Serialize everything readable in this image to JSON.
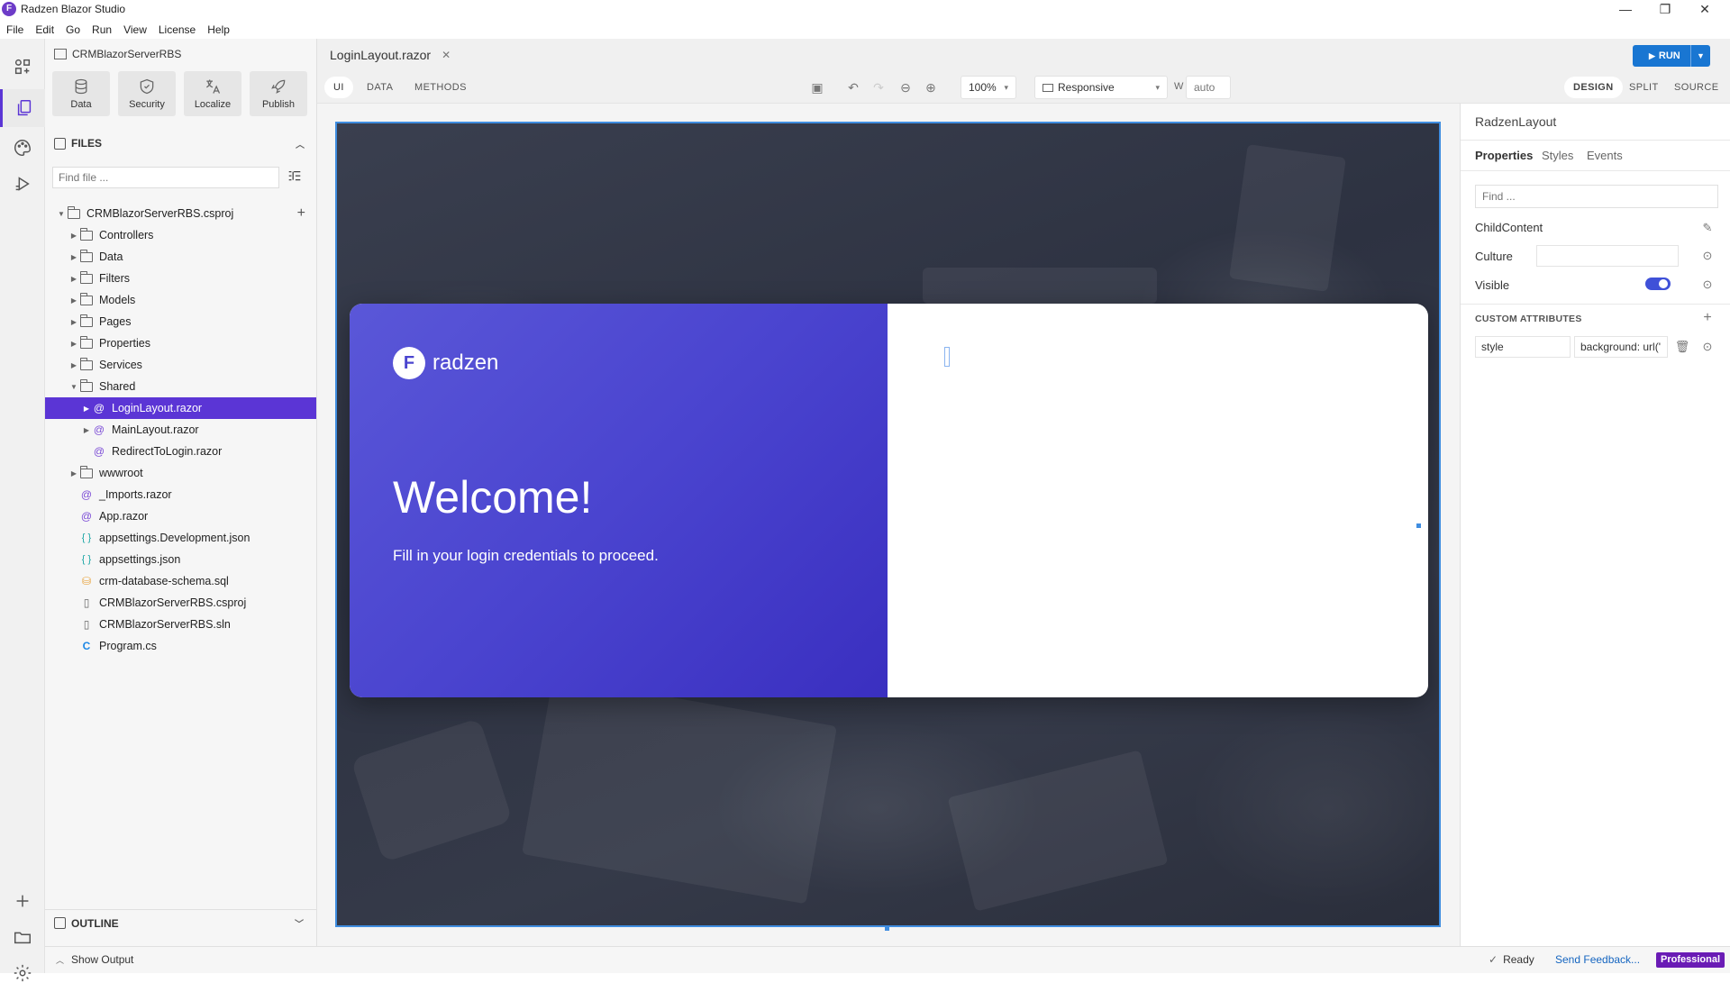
{
  "app": {
    "title": "Radzen Blazor Studio",
    "logo_letter": "F"
  },
  "window": {
    "minimize": "—",
    "maximize": "❐",
    "close": "✕"
  },
  "menu": [
    "File",
    "Edit",
    "Go",
    "Run",
    "View",
    "License",
    "Help"
  ],
  "sidebar": {
    "project": "CRMBlazorServerRBS",
    "tools": [
      {
        "label": "Data",
        "icon": "database-icon"
      },
      {
        "label": "Security",
        "icon": "shield-icon"
      },
      {
        "label": "Localize",
        "icon": "translate-icon"
      },
      {
        "label": "Publish",
        "icon": "rocket-icon"
      }
    ],
    "files_title": "FILES",
    "find_placeholder": "Find file ...",
    "tree": [
      {
        "label": "CRMBlazorServerRBS.csproj",
        "type": "folder",
        "level": 0,
        "expanded": true
      },
      {
        "label": "Controllers",
        "type": "folder",
        "level": 1,
        "expanded": false
      },
      {
        "label": "Data",
        "type": "folder",
        "level": 1,
        "expanded": false
      },
      {
        "label": "Filters",
        "type": "folder",
        "level": 1,
        "expanded": false
      },
      {
        "label": "Models",
        "type": "folder",
        "level": 1,
        "expanded": false
      },
      {
        "label": "Pages",
        "type": "folder",
        "level": 1,
        "expanded": false
      },
      {
        "label": "Properties",
        "type": "folder",
        "level": 1,
        "expanded": false
      },
      {
        "label": "Services",
        "type": "folder",
        "level": 1,
        "expanded": false
      },
      {
        "label": "Shared",
        "type": "folder",
        "level": 1,
        "expanded": true
      },
      {
        "label": "LoginLayout.razor",
        "type": "razor",
        "level": 2,
        "expanded": false,
        "selected": true,
        "has_caret": true
      },
      {
        "label": "MainLayout.razor",
        "type": "razor",
        "level": 2,
        "expanded": false,
        "has_caret": true
      },
      {
        "label": "RedirectToLogin.razor",
        "type": "razor",
        "level": 2
      },
      {
        "label": "wwwroot",
        "type": "folder",
        "level": 1,
        "expanded": false
      },
      {
        "label": "_Imports.razor",
        "type": "razor",
        "level": 1
      },
      {
        "label": "App.razor",
        "type": "razor",
        "level": 1
      },
      {
        "label": "appsettings.Development.json",
        "type": "json",
        "level": 1
      },
      {
        "label": "appsettings.json",
        "type": "json",
        "level": 1
      },
      {
        "label": "crm-database-schema.sql",
        "type": "sql",
        "level": 1
      },
      {
        "label": "CRMBlazorServerRBS.csproj",
        "type": "file",
        "level": 1
      },
      {
        "label": "CRMBlazorServerRBS.sln",
        "type": "file",
        "level": 1
      },
      {
        "label": "Program.cs",
        "type": "cs",
        "level": 1
      }
    ],
    "outline_title": "OUTLINE"
  },
  "status": {
    "show_output": "Show Output",
    "ready": "Ready",
    "feedback": "Send Feedback...",
    "license": "Professional"
  },
  "editor": {
    "file_tab": "LoginLayout.razor",
    "run_label": "RUN",
    "view_tabs": [
      "UI",
      "DATA",
      "METHODS"
    ],
    "zoom": "100%",
    "device": "Responsive",
    "width_label": "W",
    "width_value": "auto",
    "mode_tabs": [
      "DESIGN",
      "SPLIT",
      "SOURCE"
    ]
  },
  "canvas": {
    "brand_name": "radzen",
    "welcome": "Welcome!",
    "subtitle": "Fill in your login credentials to proceed."
  },
  "properties": {
    "component": "RadzenLayout",
    "tabs": [
      "Properties",
      "Styles",
      "Events"
    ],
    "find_placeholder": "Find ...",
    "rows": [
      {
        "name": "ChildContent"
      },
      {
        "name": "Culture",
        "value": ""
      },
      {
        "name": "Visible",
        "toggle": true
      }
    ],
    "custom_attributes_title": "CUSTOM ATTRIBUTES",
    "custom_attr_name": "style",
    "custom_attr_value": "background: url('"
  },
  "colors": {
    "accent": "#5b35d5",
    "run": "#1976d2",
    "canvas_border": "#3f8de0"
  }
}
